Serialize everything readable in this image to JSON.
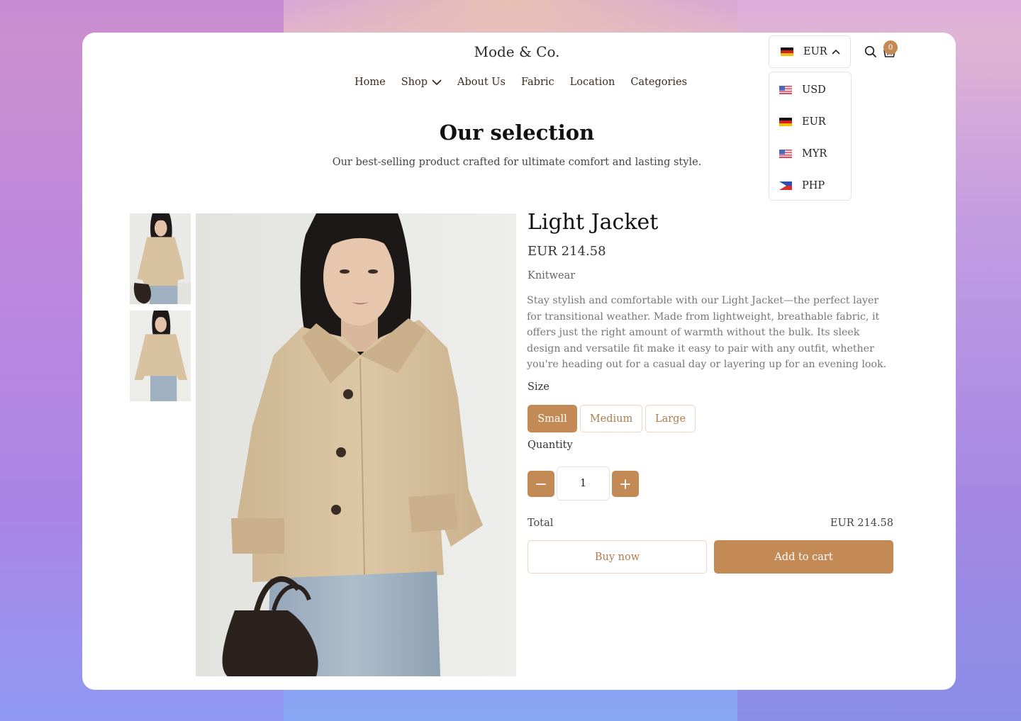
{
  "header": {
    "brand": "Mode & Co.",
    "nav": [
      {
        "label": "Home"
      },
      {
        "label": "Shop",
        "has_dropdown": true
      },
      {
        "label": "About Us"
      },
      {
        "label": "Fabric"
      },
      {
        "label": "Location"
      },
      {
        "label": "Categories"
      }
    ],
    "cart_count": "0",
    "icons": [
      "search-icon",
      "basket-icon"
    ]
  },
  "currency": {
    "selected": "EUR",
    "selected_flag": "germany-flag",
    "options": [
      {
        "code": "USD",
        "flag": "us-flag"
      },
      {
        "code": "EUR",
        "flag": "germany-flag"
      },
      {
        "code": "MYR",
        "flag": "malaysia-flag"
      },
      {
        "code": "PHP",
        "flag": "philippines-flag"
      }
    ]
  },
  "section": {
    "title": "Our selection",
    "subtitle": "Our best-selling product crafted for ultimate comfort and lasting style."
  },
  "product": {
    "name": "Light Jacket",
    "price": "EUR 214.58",
    "category": "Knitwear",
    "description": "Stay stylish and comfortable with our Light Jacket—the perfect layer for transitional weather. Made from lightweight, breathable fabric, it offers just the right amount of warmth without the bulk. Its sleek design and versatile fit make it easy to pair with any outfit, whether you're heading out for a casual day or layering up for an evening look.",
    "size_label": "Size",
    "sizes": [
      "Small",
      "Medium",
      "Large"
    ],
    "selected_size": "Small",
    "quantity_label": "Quantity",
    "quantity": "1",
    "total_label": "Total",
    "total_value": "EUR 214.58",
    "buy_now_label": "Buy now",
    "add_to_cart_label": "Add to cart"
  },
  "colors": {
    "accent": "#c38a55",
    "accent_border": "#ead7c5",
    "jacket": "#d8c2a0",
    "background_gradient": [
      "#d9a6d6",
      "#86a7f3"
    ]
  }
}
